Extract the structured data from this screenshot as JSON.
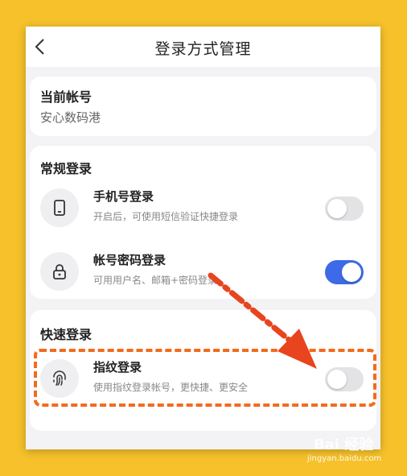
{
  "header": {
    "title": "登录方式管理",
    "back_icon": "chevron-left-icon"
  },
  "account": {
    "section_title": "当前帐号",
    "name": "安心数码港"
  },
  "normal_login": {
    "section_title": "常规登录",
    "items": [
      {
        "title": "手机号登录",
        "desc": "开启后，可使用短信验证快捷登录",
        "icon": "phone-icon",
        "enabled": false
      },
      {
        "title": "帐号密码登录",
        "desc": "可用用户名、邮箱+密码登录",
        "icon": "lock-icon",
        "enabled": true
      }
    ]
  },
  "quick_login": {
    "section_title": "快速登录",
    "items": [
      {
        "title": "指纹登录",
        "desc": "使用指纹登录帐号，更快捷、更安全",
        "icon": "fingerprint-icon",
        "enabled": false
      }
    ]
  },
  "watermark": {
    "logo": "Bai 经验",
    "url": "jingyan.baidu.com"
  },
  "colors": {
    "background": "#F6C12A",
    "toggle_on": "#3D6AE6",
    "annotation": "#E8441E"
  }
}
